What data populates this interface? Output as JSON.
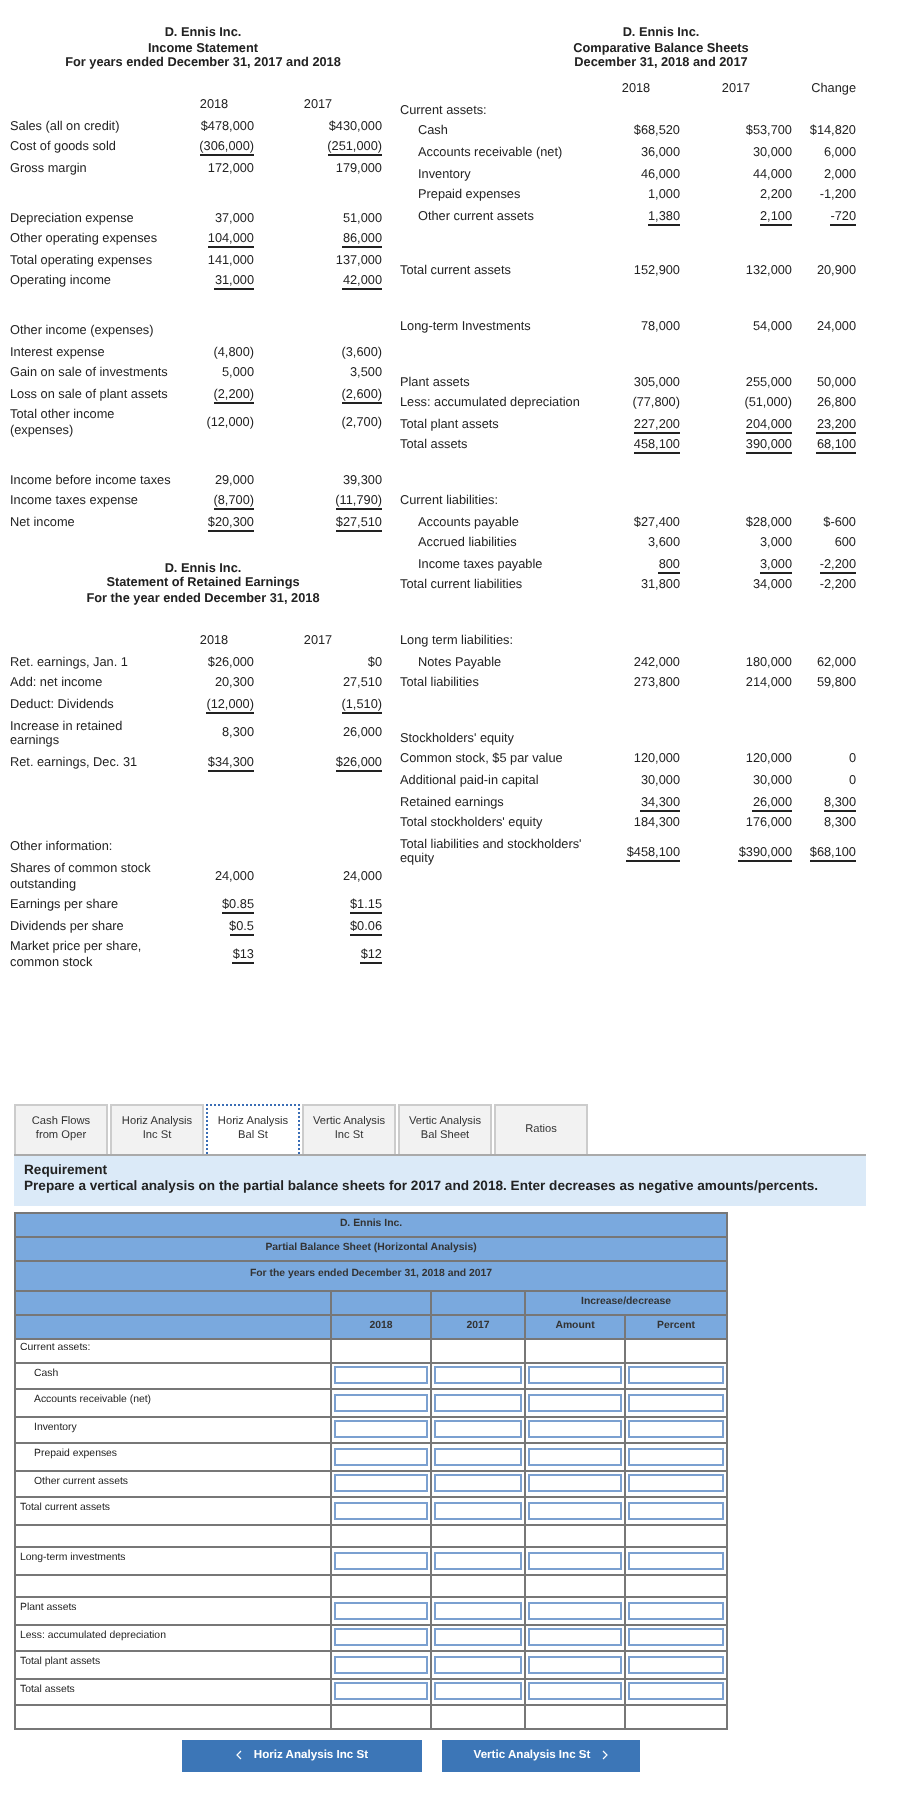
{
  "left_column": [
    {
      "company": "D. Ennis Inc.",
      "title": "Income Statement",
      "period": "For years ended December 31, 2017 and 2018",
      "columns": [
        "2018",
        "2017"
      ],
      "sections": [
        {
          "rows": [
            {
              "label": "Sales (all on credit)",
              "values": [
                "$478,000",
                "$430,000"
              ],
              "underlined": false,
              "indented": false
            },
            {
              "label": "Cost of goods sold",
              "values": [
                "(306,000)",
                "(251,000)"
              ],
              "underlined": true,
              "indented": false
            },
            {
              "label": "Gross margin",
              "values": [
                "172,000",
                "179,000"
              ],
              "underlined": false,
              "indented": false
            }
          ]
        },
        {
          "rows": [
            {
              "label": "Depreciation expense",
              "values": [
                "37,000",
                "51,000"
              ],
              "underlined": false,
              "indented": false
            },
            {
              "label": "Other operating expenses",
              "values": [
                "104,000",
                "86,000"
              ],
              "underlined": true,
              "indented": false
            },
            {
              "label": "Total operating expenses",
              "values": [
                "141,000",
                "137,000"
              ],
              "underlined": false,
              "indented": false
            },
            {
              "label": "Operating income",
              "values": [
                "31,000",
                "42,000"
              ],
              "underlined": true,
              "indented": false
            }
          ]
        },
        {
          "rows": [
            {
              "label": "Other income (expenses)",
              "indented": false
            },
            {
              "label": "Interest expense",
              "values": [
                "(4,800)",
                "(3,600)"
              ],
              "underlined": false,
              "indented": false
            },
            {
              "label": "Gain on sale of investments",
              "values": [
                "5,000",
                "3,500"
              ],
              "underlined": false,
              "indented": false
            },
            {
              "label": "Loss on sale of plant assets",
              "values": [
                "(2,200)",
                "(2,600)"
              ],
              "underlined": true,
              "indented": false
            },
            {
              "label": "Total other income (expenses)",
              "values": [
                "(12,000)",
                "(2,700)"
              ],
              "underlined": false,
              "indented": false
            }
          ]
        },
        {
          "rows": [
            {
              "label": "Income before income taxes",
              "values": [
                "29,000",
                "39,300"
              ],
              "underlined": false,
              "indented": false
            },
            {
              "label": "Income taxes expense",
              "values": [
                "(8,700)",
                "(11,790)"
              ],
              "underlined": true,
              "indented": false
            },
            {
              "label": "Net income",
              "values": [
                "$20,300",
                "$27,510"
              ],
              "underlined": true,
              "indented": false
            }
          ]
        }
      ]
    },
    {
      "company": "D. Ennis Inc.",
      "title": "Statement of Retained Earnings",
      "period": "For the year ended December 31, 2018",
      "columns": [
        "2018",
        "2017"
      ],
      "sections": [
        {
          "rows": [
            {
              "label": "Ret. earnings, Jan. 1",
              "values": [
                "$26,000",
                "$0"
              ],
              "underlined": false,
              "indented": false
            },
            {
              "label": "Add: net income",
              "values": [
                "20,300",
                "27,510"
              ],
              "underlined": false,
              "indented": false
            },
            {
              "label": "Deduct: Dividends",
              "values": [
                "(12,000)",
                "(1,510)"
              ],
              "underlined": true,
              "indented": false
            },
            {
              "label": "Increase in retained earnings",
              "values": [
                "8,300",
                "26,000"
              ],
              "underlined": false,
              "indented": false
            },
            {
              "label": "Ret. earnings, Dec. 31",
              "values": [
                "$34,300",
                "$26,000"
              ],
              "underlined": true,
              "indented": false
            }
          ]
        }
      ]
    },
    {
      "sections": [
        {
          "rows": [
            {
              "label": "Other information:",
              "indented": false
            },
            {
              "label": "Shares of common stock outstanding",
              "values": [
                "24,000",
                "24,000"
              ],
              "underlined": false,
              "indented": false
            },
            {
              "label": "Earnings per share",
              "values": [
                "$0.85",
                "$1.15"
              ],
              "underlined": true,
              "indented": false
            },
            {
              "label": "Dividends per share",
              "values": [
                "$0.5",
                "$0.06"
              ],
              "underlined": true,
              "indented": false
            },
            {
              "label": "Market price per share, common stock",
              "values": [
                "$13",
                "$12"
              ],
              "underlined": true,
              "indented": false
            }
          ]
        }
      ]
    }
  ],
  "right_column": [
    {
      "company": "D. Ennis Inc.",
      "title": "Comparative Balance Sheets",
      "period": "December 31, 2018 and 2017",
      "columns": [
        "2018",
        "2017",
        "Change"
      ],
      "sections": [
        {
          "rows": [
            {
              "label": "Current assets:",
              "indented": false
            },
            {
              "label": "Cash",
              "values": [
                "$68,520",
                "$53,700",
                "$14,820"
              ],
              "underlined": false,
              "indented": true
            },
            {
              "label": "Accounts receivable (net)",
              "values": [
                "36,000",
                "30,000",
                "6,000"
              ],
              "underlined": false,
              "indented": true
            },
            {
              "label": "Inventory",
              "values": [
                "46,000",
                "44,000",
                "2,000"
              ],
              "underlined": false,
              "indented": true
            },
            {
              "label": "Prepaid expenses",
              "values": [
                "1,000",
                "2,200",
                "-1,200"
              ],
              "underlined": false,
              "indented": true
            },
            {
              "label": "Other current assets",
              "values": [
                "1,380",
                "2,100",
                "-720"
              ],
              "underlined": true,
              "indented": true
            }
          ]
        },
        {
          "rows": [
            {
              "label": "Total current assets",
              "values": [
                "152,900",
                "132,000",
                "20,900"
              ],
              "underlined": false,
              "indented": false
            }
          ]
        },
        {
          "rows": [
            {
              "label": "Long-term Investments",
              "values": [
                "78,000",
                "54,000",
                "24,000"
              ],
              "underlined": false,
              "indented": false
            }
          ]
        },
        {
          "rows": [
            {
              "label": "Plant assets",
              "values": [
                "305,000",
                "255,000",
                "50,000"
              ],
              "underlined": false,
              "indented": false
            },
            {
              "label": "Less: accumulated depreciation",
              "values": [
                "(77,800)",
                "(51,000)",
                "26,800"
              ],
              "underlined": false,
              "indented": false
            },
            {
              "label": "Total plant assets",
              "values": [
                "227,200",
                "204,000",
                "23,200"
              ],
              "underlined": true,
              "indented": false
            },
            {
              "label": "Total assets",
              "values": [
                "458,100",
                "390,000",
                "68,100"
              ],
              "underlined": true,
              "indented": false
            }
          ]
        },
        {
          "rows": [
            {
              "label": "Current liabilities:",
              "indented": false
            },
            {
              "label": "Accounts payable",
              "values": [
                "$27,400",
                "$28,000",
                "$-600"
              ],
              "underlined": false,
              "indented": true
            },
            {
              "label": "Accrued liabilities",
              "values": [
                "3,600",
                "3,000",
                "600"
              ],
              "underlined": false,
              "indented": true
            },
            {
              "label": "Income taxes payable",
              "values": [
                "800",
                "3,000",
                "-2,200"
              ],
              "underlined": true,
              "indented": true
            },
            {
              "label": "Total current liabilities",
              "values": [
                "31,800",
                "34,000",
                "-2,200"
              ],
              "underlined": false,
              "indented": false
            }
          ]
        },
        {
          "rows": [
            {
              "label": "Long term liabilities:",
              "indented": false
            },
            {
              "label": "Notes Payable",
              "values": [
                "242,000",
                "180,000",
                "62,000"
              ],
              "underlined": false,
              "indented": true
            },
            {
              "label": "Total liabilities",
              "values": [
                "273,800",
                "214,000",
                "59,800"
              ],
              "underlined": false,
              "indented": false
            }
          ]
        },
        {
          "rows": [
            {
              "label": "Stockholders' equity",
              "indented": false
            },
            {
              "label": "Common stock, $5 par value",
              "values": [
                "120,000",
                "120,000",
                "0"
              ],
              "underlined": false,
              "indented": false
            },
            {
              "label": "Additional paid-in capital",
              "values": [
                "30,000",
                "30,000",
                "0"
              ],
              "underlined": false,
              "indented": false
            },
            {
              "label": "Retained earnings",
              "values": [
                "34,300",
                "26,000",
                "8,300"
              ],
              "underlined": true,
              "indented": false
            },
            {
              "label": "Total stockholders' equity",
              "values": [
                "184,300",
                "176,000",
                "8,300"
              ],
              "underlined": false,
              "indented": false
            },
            {
              "label": "Total liabilities and stockholders' equity",
              "values": [
                "$458,100",
                "$390,000",
                "$68,100"
              ],
              "underlined": true,
              "indented": false
            }
          ]
        }
      ]
    }
  ],
  "tabs": [
    {
      "label": "Cash Flows from Oper",
      "selected": false
    },
    {
      "label": "Horiz Analysis Inc St",
      "selected": false
    },
    {
      "label": "Horiz Analysis Bal St",
      "selected": true
    },
    {
      "label": "Vertic Analysis Inc St",
      "selected": false
    },
    {
      "label": "Vertic Analysis Bal Sheet",
      "selected": false
    },
    {
      "label": "Ratios",
      "selected": false
    }
  ],
  "requirement": {
    "title": "Requirement",
    "text": "Prepare a vertical analysis on the partial balance sheets for 2017 and 2018.  Enter decreases as negative amounts/percents."
  },
  "answer_table": {
    "company": "D. Ennis Inc.",
    "title": "Partial Balance Sheet (Horizontal Analysis)",
    "period": "For the years ended December 31, 2018 and 2017",
    "group_header": "Increase/decrease",
    "columns": [
      "2018",
      "2017",
      "Amount",
      "Percent"
    ],
    "rows": [
      {
        "kind": "heading",
        "label": "Current assets:",
        "indented": false
      },
      {
        "kind": "input",
        "label": "Cash",
        "indented": true
      },
      {
        "kind": "input",
        "label": "Accounts receivable (net)",
        "indented": true
      },
      {
        "kind": "input",
        "label": "Inventory",
        "indented": true
      },
      {
        "kind": "input",
        "label": "Prepaid expenses",
        "indented": true
      },
      {
        "kind": "input",
        "label": "Other current assets",
        "indented": true
      },
      {
        "kind": "input",
        "label": "Total current assets",
        "indented": false
      },
      {
        "kind": "blank"
      },
      {
        "kind": "input",
        "label": "Long-term investments",
        "indented": false
      },
      {
        "kind": "blank"
      },
      {
        "kind": "input",
        "label": "Plant assets",
        "indented": false
      },
      {
        "kind": "input",
        "label": "Less:  accumulated depreciation",
        "indented": false
      },
      {
        "kind": "input",
        "label": "Total plant assets",
        "indented": false
      },
      {
        "kind": "input",
        "label": "Total assets",
        "indented": false
      },
      {
        "kind": "blank"
      }
    ]
  },
  "nav": {
    "previous": "Horiz Analysis Inc St",
    "next": "Vertic Analysis Inc St"
  }
}
